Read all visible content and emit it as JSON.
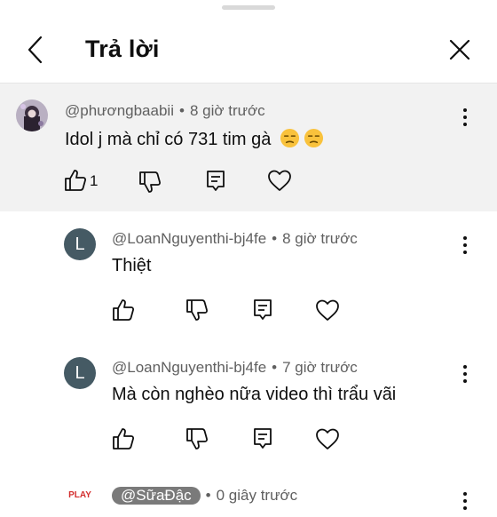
{
  "header": {
    "title": "Trả lời",
    "back_icon": "chevron-left-icon",
    "close_icon": "close-icon"
  },
  "top_comment": {
    "handle": "@phươngbaabii",
    "separator": "•",
    "time": "8 giờ trước",
    "text": "Idol j mà chỉ có 731 tim gà",
    "emojis": [
      "unamused-face-icon",
      "unamused-face-icon"
    ],
    "like_count": "1"
  },
  "replies": [
    {
      "avatar_letter": "L",
      "handle": "@LoanNguyenthi-bj4fe",
      "separator": "•",
      "time": "8 giờ trước",
      "text": "Thiệt"
    },
    {
      "avatar_letter": "L",
      "handle": "@LoanNguyenthi-bj4fe",
      "separator": "•",
      "time": "7 giờ trước",
      "text": "Mà còn nghèo nữa video thì trẩu  vãi"
    },
    {
      "avatar_label": "PLAY",
      "handle": "@SữaĐậc",
      "separator": "•",
      "time": "0 giây trước"
    }
  ],
  "colors": {
    "highlight_bg": "#f2f2f2",
    "avatar_letter_bg": "#455a64",
    "meta_text": "#606060"
  }
}
